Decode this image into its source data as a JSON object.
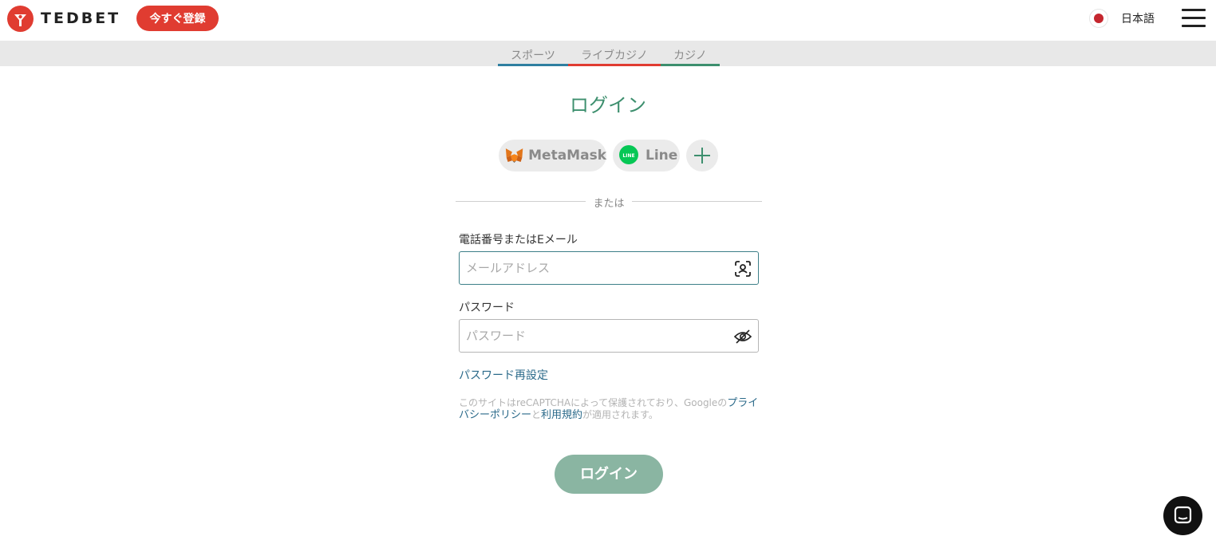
{
  "header": {
    "logo_text": "TEDBET",
    "signup_label": "今すぐ登録",
    "language_label": "日本語",
    "icons": {
      "logo": "tedbet-logo-icon",
      "flag": "japan-flag-icon",
      "menu": "hamburger-menu-icon"
    }
  },
  "nav": {
    "tabs": [
      {
        "label": "スポーツ",
        "color": "#2f7fa0"
      },
      {
        "label": "ライブカジノ",
        "color": "#e03c31"
      },
      {
        "label": "カジノ",
        "color": "#3d8f6e"
      }
    ]
  },
  "login": {
    "title": "ログイン",
    "social": [
      {
        "label": "MetaMask",
        "icon": "metamask-fox-icon"
      },
      {
        "label": "Line",
        "icon": "line-icon"
      },
      {
        "label": "",
        "icon": "plus-icon"
      }
    ],
    "divider_text": "または",
    "email_label": "電話番号またはEメール",
    "email_placeholder": "メールアドレス",
    "email_value": "",
    "password_label": "パスワード",
    "password_placeholder": "パスワード",
    "password_value": "",
    "forgot_label": "パスワード再設定",
    "recaptcha_prefix": "このサイトはreCAPTCHAによって保護されており、Googleの",
    "privacy_link": "プライバシーポリシー",
    "and_text": "と",
    "terms_link": "利用規約",
    "recaptcha_suffix": "が適用されます。",
    "submit_label": "ログイン"
  },
  "colors": {
    "brand_red": "#e03c31",
    "accent_green": "#3d8f6e",
    "link_blue": "#2b6a8a",
    "button_disabled": "#8ab5a2"
  },
  "chat": {
    "icon": "chat-bubble-icon"
  }
}
